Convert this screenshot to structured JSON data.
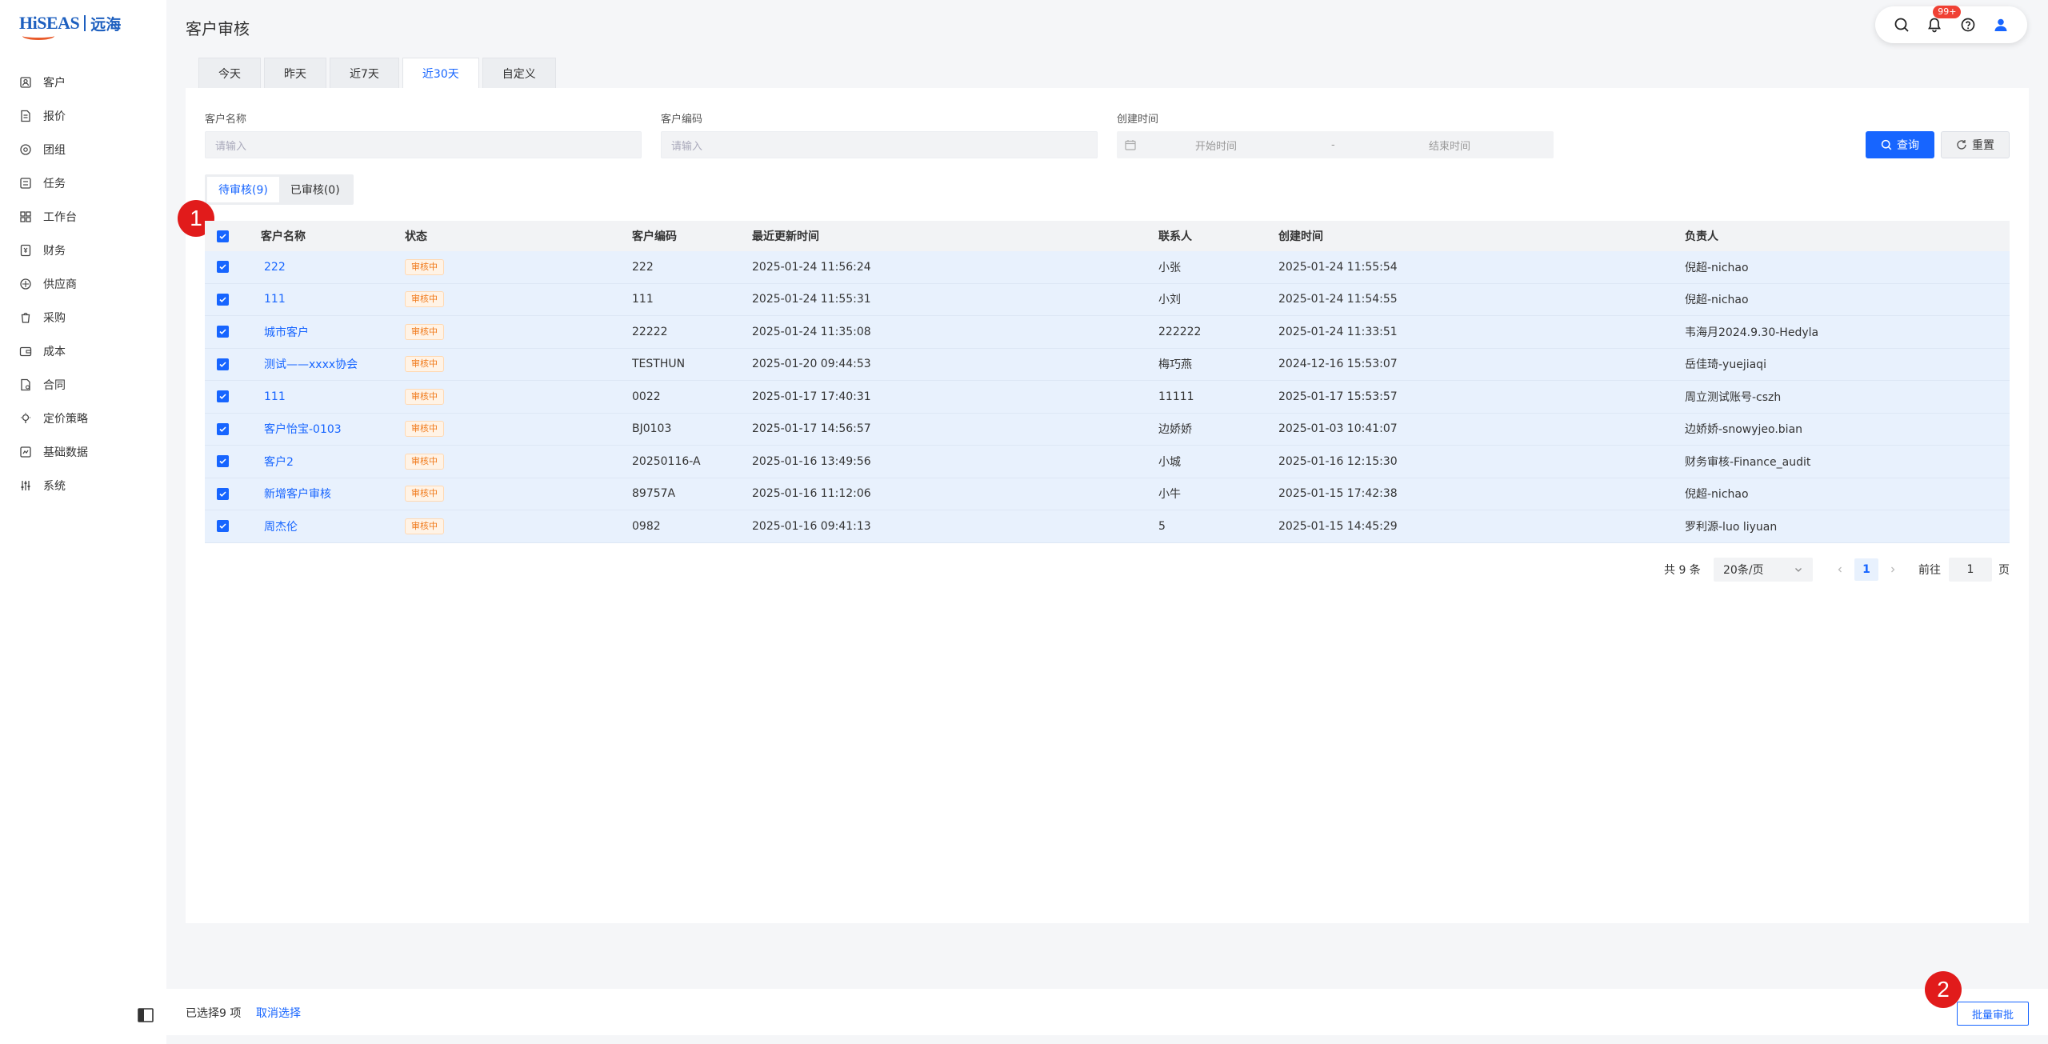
{
  "app": {
    "logo_text": "HiSEAS",
    "logo_cn": "远海"
  },
  "page_title": "客户审核",
  "sidebar": {
    "items": [
      {
        "label": "客户",
        "icon": "customer-icon"
      },
      {
        "label": "报价",
        "icon": "quote-icon"
      },
      {
        "label": "团组",
        "icon": "group-icon"
      },
      {
        "label": "任务",
        "icon": "task-icon"
      },
      {
        "label": "工作台",
        "icon": "dashboard-icon"
      },
      {
        "label": "财务",
        "icon": "finance-icon"
      },
      {
        "label": "供应商",
        "icon": "supplier-icon"
      },
      {
        "label": "采购",
        "icon": "purchase-icon"
      },
      {
        "label": "成本",
        "icon": "cost-icon"
      },
      {
        "label": "合同",
        "icon": "contract-icon"
      },
      {
        "label": "定价策略",
        "icon": "pricing-icon"
      },
      {
        "label": "基础数据",
        "icon": "basedata-icon"
      },
      {
        "label": "系统",
        "icon": "settings-sliders-icon"
      }
    ]
  },
  "toolbar": {
    "notification_badge": "99+"
  },
  "date_tabs": [
    "今天",
    "昨天",
    "近7天",
    "近30天",
    "自定义"
  ],
  "active_date_tab": "近30天",
  "filters": {
    "customer_name_label": "客户名称",
    "customer_name_placeholder": "请输入",
    "customer_code_label": "客户编码",
    "customer_code_placeholder": "请输入",
    "created_time_label": "创建时间",
    "start_placeholder": "开始时间",
    "range_sep": "-",
    "end_placeholder": "结束时间",
    "query_label": "查询",
    "reset_label": "重置"
  },
  "status_tabs": [
    "待审核(9)",
    "已审核(0)"
  ],
  "table": {
    "columns": [
      "客户名称",
      "状态",
      "客户编码",
      "最近更新时间",
      "联系人",
      "创建时间",
      "负责人"
    ],
    "rows": [
      {
        "name": "222",
        "status": "审核中",
        "code": "222",
        "updated": "2025-01-24 11:56:24",
        "contact": "小张",
        "created": "2025-01-24 11:55:54",
        "owner": "倪超-nichao"
      },
      {
        "name": "111",
        "status": "审核中",
        "code": "111",
        "updated": "2025-01-24 11:55:31",
        "contact": "小刘",
        "created": "2025-01-24 11:54:55",
        "owner": "倪超-nichao"
      },
      {
        "name": "城市客户",
        "status": "审核中",
        "code": "22222",
        "updated": "2025-01-24 11:35:08",
        "contact": "222222",
        "created": "2025-01-24 11:33:51",
        "owner": "韦海月2024.9.30-Hedyla"
      },
      {
        "name": "测试——xxxx协会",
        "status": "审核中",
        "code": "TESTHUN",
        "updated": "2025-01-20 09:44:53",
        "contact": "梅巧燕",
        "created": "2024-12-16 15:53:07",
        "owner": "岳佳琦-yuejiaqi"
      },
      {
        "name": "111",
        "status": "审核中",
        "code": "0022",
        "updated": "2025-01-17 17:40:31",
        "contact": "11111",
        "created": "2025-01-17 15:53:57",
        "owner": "周立测试账号-cszh"
      },
      {
        "name": "客户怡宝-0103",
        "status": "审核中",
        "code": "BJ0103",
        "updated": "2025-01-17 14:56:57",
        "contact": "边娇娇",
        "created": "2025-01-03 10:41:07",
        "owner": "边娇娇-snowyjeo.bian"
      },
      {
        "name": "客户2",
        "status": "审核中",
        "code": "20250116-A",
        "updated": "2025-01-16 13:49:56",
        "contact": "小城",
        "created": "2025-01-16 12:15:30",
        "owner": "财务审核-Finance_audit"
      },
      {
        "name": "新增客户审核",
        "status": "审核中",
        "code": "89757A",
        "updated": "2025-01-16 11:12:06",
        "contact": "小牛",
        "created": "2025-01-15 17:42:38",
        "owner": "倪超-nichao"
      },
      {
        "name": "周杰伦",
        "status": "审核中",
        "code": "0982",
        "updated": "2025-01-16 09:41:13",
        "contact": "5",
        "created": "2025-01-15 14:45:29",
        "owner": "罗利源-luo liyuan"
      }
    ]
  },
  "pagination": {
    "total_text": "共 9 条",
    "page_size": "20条/页",
    "current_page": "1",
    "goto_label": "前往",
    "goto_value": "1",
    "page_suffix": "页"
  },
  "footer": {
    "selected_text": "已选择9 项",
    "cancel_label": "取消选择",
    "batch_label": "批量审批"
  },
  "markers": [
    "1",
    "2"
  ],
  "colors": {
    "primary": "#1765ff",
    "marker": "#e11b1b",
    "status_tag": "#f07a1b"
  }
}
